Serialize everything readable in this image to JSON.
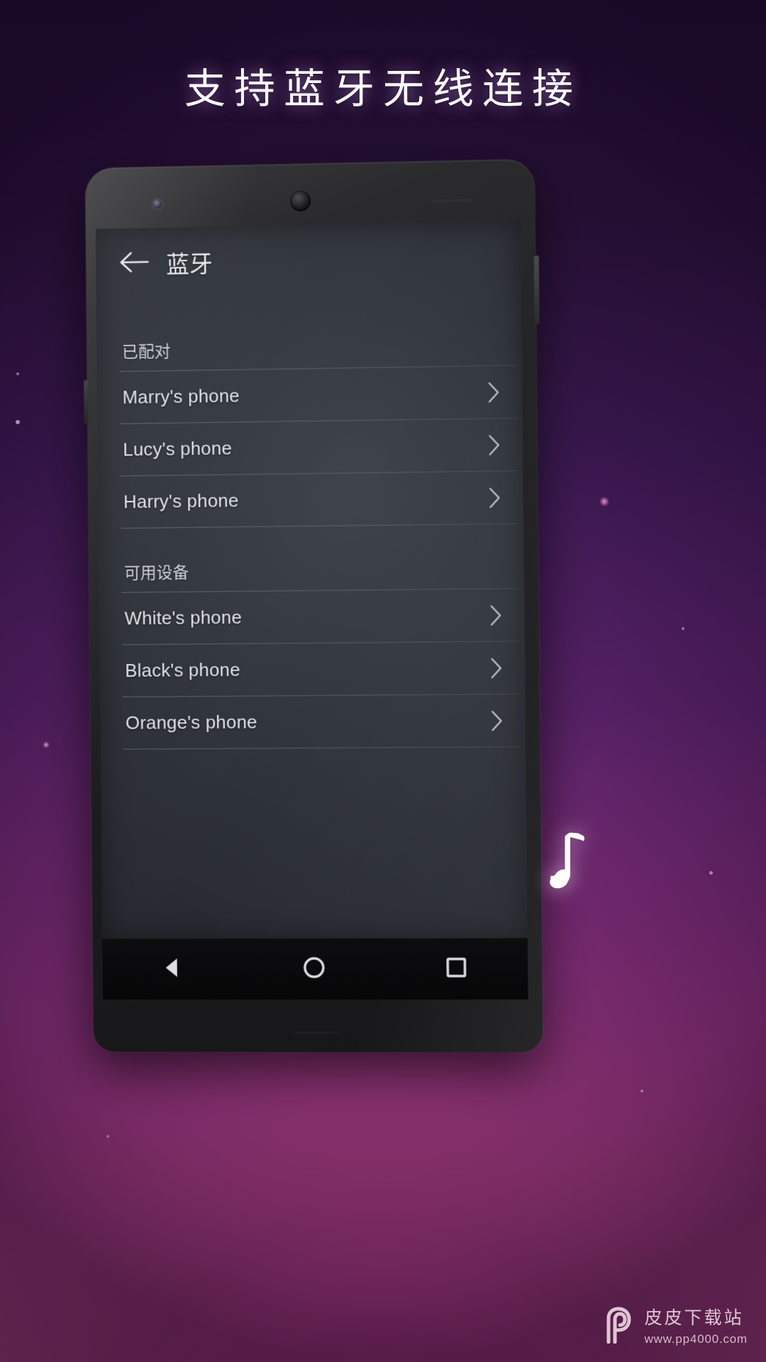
{
  "headline": "支持蓝牙无线连接",
  "phone": {
    "appbar": {
      "back_icon": "arrow-left-icon",
      "title": "蓝牙"
    },
    "sections": [
      {
        "header": "已配对",
        "items": [
          {
            "label": "Marry's phone",
            "chevron": "chevron-right-icon"
          },
          {
            "label": "Lucy's phone",
            "chevron": "chevron-right-icon"
          },
          {
            "label": "Harry's phone",
            "chevron": "chevron-right-icon"
          }
        ]
      },
      {
        "header": "可用设备",
        "items": [
          {
            "label": "White's phone",
            "chevron": "chevron-right-icon"
          },
          {
            "label": "Black's phone",
            "chevron": "chevron-right-icon"
          },
          {
            "label": "Orange's phone",
            "chevron": "chevron-right-icon"
          }
        ]
      }
    ],
    "navbar": {
      "back": "triangle-back-icon",
      "home": "circle-home-icon",
      "recents": "square-recents-icon"
    }
  },
  "decor": {
    "music_note_icon": "music-note-icon"
  },
  "watermark": {
    "logo_icon": "pp-logo-icon",
    "title": "皮皮下载站",
    "url": "www.pp4000.com"
  },
  "colors": {
    "headline_text": "#fdfdff",
    "screen_bg": "#343940",
    "row_text": "#e2e5ea",
    "section_text": "#d2d6dc",
    "accent_pink": "#dd5a9e",
    "accent_purple": "#542063",
    "watermark_text": "#ffeaf3"
  }
}
